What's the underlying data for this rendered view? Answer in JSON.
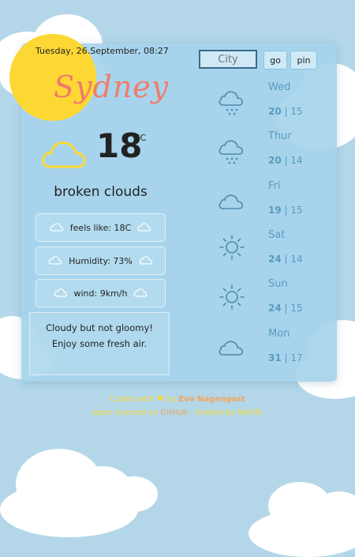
{
  "header": {
    "datetime": "Tuesday, 26.September, 08:27",
    "city_name": "Sydney"
  },
  "search": {
    "placeholder": "City",
    "go_label": "go",
    "pin_label": "pin"
  },
  "current": {
    "icon": "cloud-icon",
    "temperature": "18",
    "unit": "°C",
    "description": "broken clouds",
    "feels_like": "feels like: 18C",
    "humidity": "Humidity: 73%",
    "wind": "wind: 9km/h",
    "note_line1": "Cloudy but not gloomy!",
    "note_line2": "Enjoy some fresh air."
  },
  "forecast": [
    {
      "day": "Wed",
      "high": "20",
      "low": "15",
      "icon": "snow-cloud-icon"
    },
    {
      "day": "Thur",
      "high": "20",
      "low": "14",
      "icon": "snow-cloud-icon"
    },
    {
      "day": "Fri",
      "high": "19",
      "low": "15",
      "icon": "cloud-icon"
    },
    {
      "day": "Sat",
      "high": "24",
      "low": "14",
      "icon": "sun-icon"
    },
    {
      "day": "Sun",
      "high": "24",
      "low": "15",
      "icon": "sun-icon"
    },
    {
      "day": "Mon",
      "high": "31",
      "low": "17",
      "icon": "cloud-icon"
    }
  ],
  "footer": {
    "coded_with": "Coded with",
    "by": "by",
    "author": "Eva Nagengast",
    "open_sourced": "open sourced on",
    "github": "GitHub",
    "hosted": "hosted by Netlify"
  },
  "colors": {
    "background": "#b3d7e9",
    "card": "#a6d4eb",
    "accent_city": "#f27b6a",
    "sun": "#fdd835",
    "forecast_text": "#5a9bc0"
  }
}
